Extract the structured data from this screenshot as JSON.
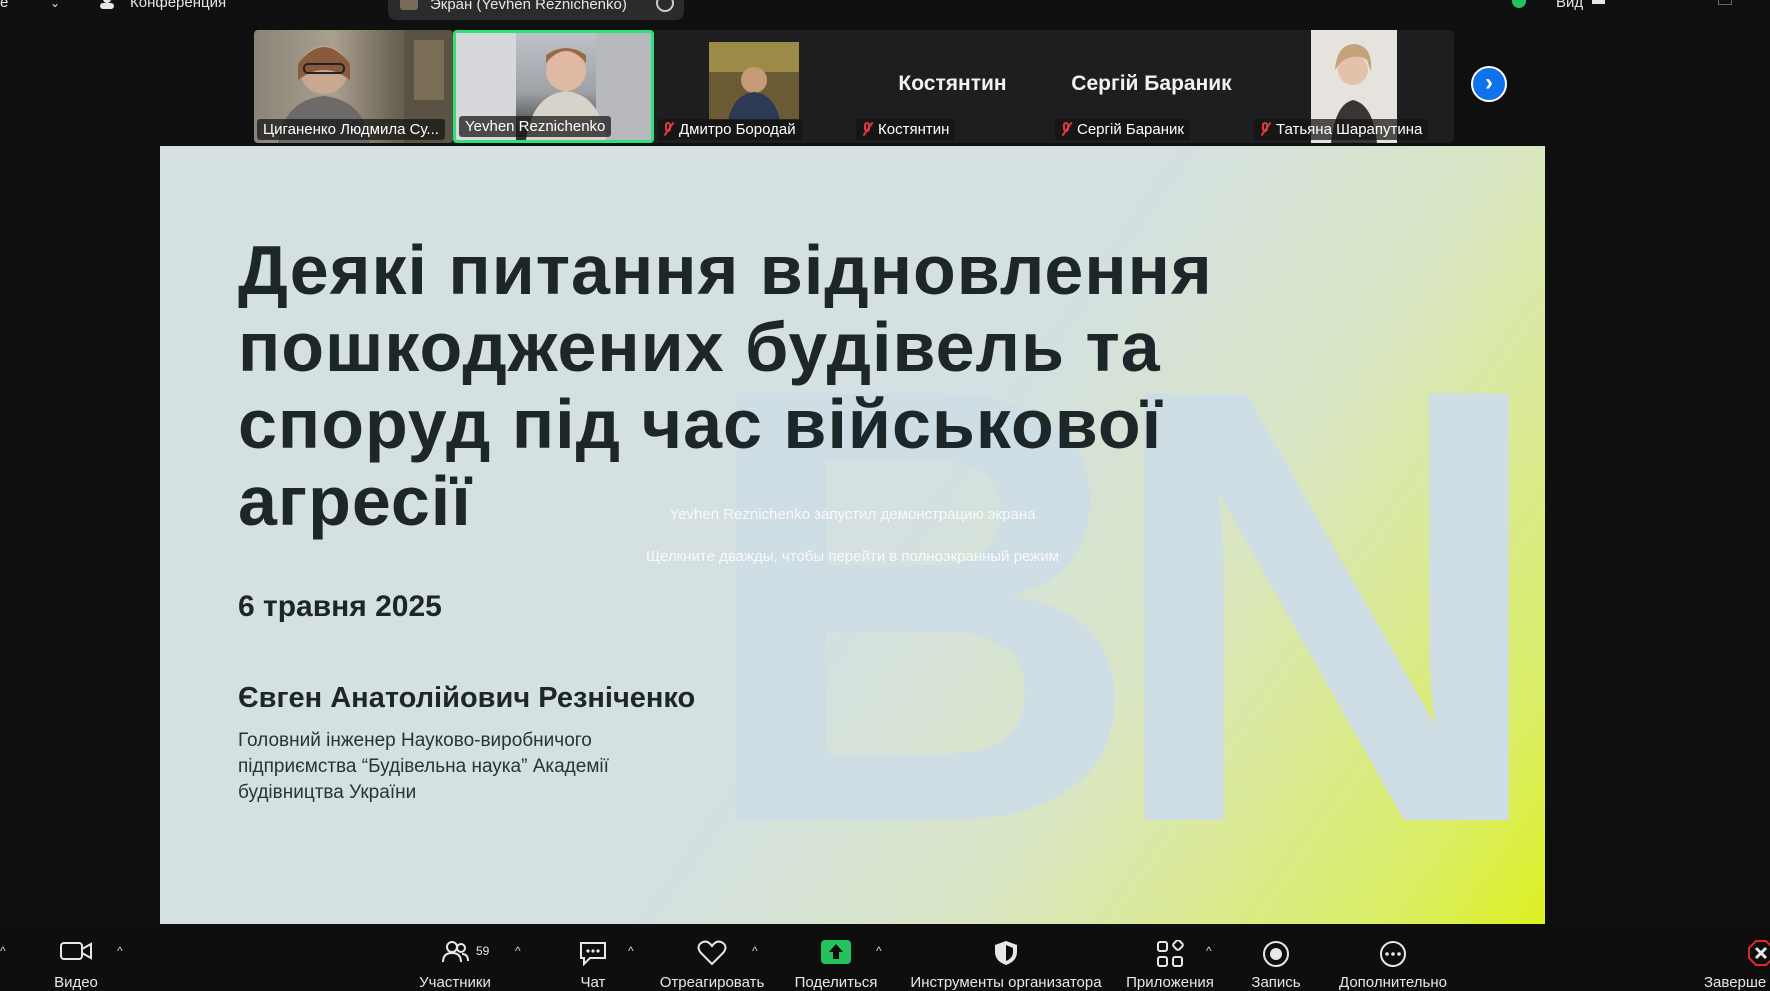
{
  "top_bar": {
    "conference_label": "Конференция",
    "share_label": "Экран (Yevhen Reznichenko)",
    "view_label": "Вид"
  },
  "participants_strip": [
    {
      "name": "Циганенко Людмила Су...",
      "has_video": true,
      "muted": false
    },
    {
      "name": "Yevhen Reznichenko",
      "has_video": true,
      "muted": false,
      "active_speaker": true
    },
    {
      "name": "Дмитро Бородай",
      "has_video": true,
      "muted": true
    },
    {
      "name": "Костянтин",
      "display": "Костянтин",
      "has_video": false,
      "muted": true
    },
    {
      "name": "Сергій Бараник",
      "display": "Сергій Бараник",
      "has_video": false,
      "muted": true
    },
    {
      "name": "Татьяна Шарапутина",
      "has_video": true,
      "muted": true
    }
  ],
  "slide": {
    "title": "Деякі питання відновлення пошкоджених будівель та споруд під час військової агресії",
    "date": "6 травня 2025",
    "author": "Євген Анатолійович Резніченко",
    "affiliation": "Головний інженер Науково-виробничого підприємства “Будівельна наука” Академії будівництва України",
    "watermark": "BN"
  },
  "overlay": {
    "line1": "Yevhen Reznichenko запустил демонстрацию экрана",
    "line2": "Щелкните дважды, чтобы перейти в полноэкранный режим"
  },
  "toolbar": {
    "video": "Видео",
    "participants": "Участники",
    "participants_count": "59",
    "chat": "Чат",
    "react": "Отреагировать",
    "share": "Поделиться",
    "host_tools": "Инструменты организатора",
    "apps": "Приложения",
    "record": "Запись",
    "more": "Дополнительно",
    "end": "Заверше"
  },
  "colors": {
    "accent_blue": "#0e72ed",
    "share_green": "#22c35f",
    "active_speaker_border": "#2ee07a",
    "muted_red": "#e03b3b",
    "end_red": "#e02828"
  }
}
